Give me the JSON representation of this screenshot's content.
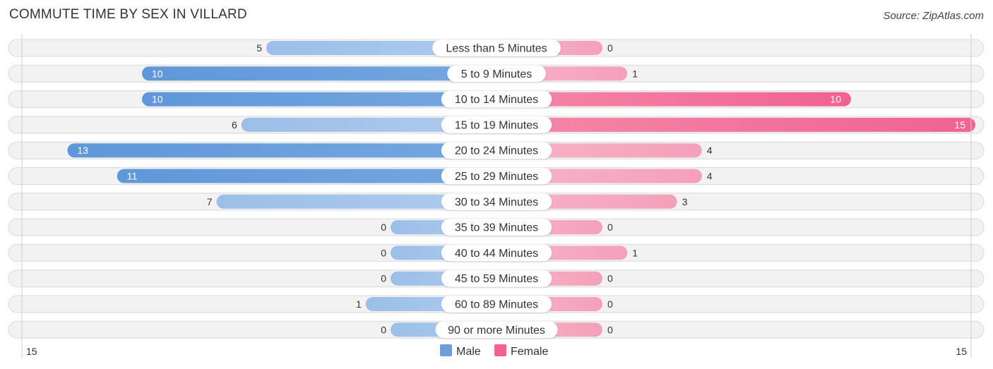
{
  "header": {
    "title": "COMMUTE TIME BY SEX IN VILLARD",
    "source": "Source: ZipAtlas.com"
  },
  "chart_data": {
    "type": "bar",
    "orientation": "horizontal-diverging",
    "title": "COMMUTE TIME BY SEX IN VILLARD",
    "categories": [
      "Less than 5 Minutes",
      "5 to 9 Minutes",
      "10 to 14 Minutes",
      "15 to 19 Minutes",
      "20 to 24 Minutes",
      "25 to 29 Minutes",
      "30 to 34 Minutes",
      "35 to 39 Minutes",
      "40 to 44 Minutes",
      "45 to 59 Minutes",
      "60 to 89 Minutes",
      "90 or more Minutes"
    ],
    "series": [
      {
        "name": "Male",
        "color": "#6a9fdc",
        "values": [
          5,
          10,
          10,
          6,
          13,
          11,
          7,
          0,
          0,
          0,
          1,
          0
        ]
      },
      {
        "name": "Female",
        "color": "#f06292",
        "values": [
          0,
          1,
          10,
          15,
          4,
          4,
          3,
          0,
          1,
          0,
          0,
          0
        ]
      }
    ],
    "axis": {
      "left_label": "15",
      "right_label": "15",
      "max": 15
    },
    "legend": {
      "position": "bottom-center",
      "items": [
        "Male",
        "Female"
      ]
    },
    "xlabel": "",
    "ylabel": ""
  }
}
